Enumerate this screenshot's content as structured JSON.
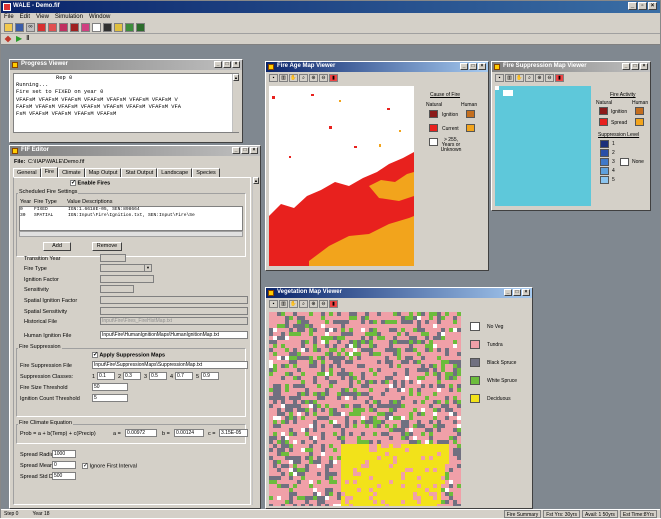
{
  "app": {
    "title": "WALE - Demo.fif",
    "menu": [
      "File",
      "Edit",
      "View",
      "Simulation",
      "Window"
    ],
    "status_left": [
      "Step 0",
      "Year 18"
    ],
    "status_right": [
      "Fire Summary",
      "Fst Yrs: 30yrs",
      "Avail: 1 50yrs",
      "Est Time:8Yrs"
    ]
  },
  "progress": {
    "title": "Progress Viewer",
    "lines": [
      "Rep 0",
      "Running...",
      "",
      "Fire set to FIXED on year 0",
      " VFAFsM VFAFsM VFAFsM VFAFsM VFAFsM VFAFsM VFAFsM V",
      "FAFsM VFAFsM VFAFsM VFAFsM VFAFsM VFAFsM VFAFsM VFA",
      "FsM VFAFsM VFAFsM VFAFsM VFAFsM"
    ]
  },
  "editor": {
    "title": "FIF Editor",
    "file_label": "File:",
    "file_path": "C:\\IIAP\\WALE\\Demo.fif",
    "tabs": [
      "General",
      "Fire",
      "Climate",
      "Map Output",
      "Stat Output",
      "Landscape",
      "Species"
    ],
    "enable_fires": "Enable Fires",
    "scheduled_title": "Scheduled Fire Settings",
    "table_headers": [
      "Year",
      "Fire Type",
      "Value Descriptions"
    ],
    "table_rows": [
      [
        "0",
        "FIXED",
        "IGN:1.6618E-05, SEN:898664"
      ],
      [
        "30",
        "SPATIAL",
        "IGN:Input\\Fire\\Ignition.txt, SEN:Input\\Fire\\Se"
      ]
    ],
    "add": "Add",
    "remove": "Remove",
    "fields": [
      "Transition Year",
      "Fire Type",
      "Ignition Factor",
      "Sensitivity",
      "Spatial Ignition Factor",
      "Spatial Sensitivity",
      "Historical File"
    ],
    "historical_file": "Input\\Fire\\Fires_FireHistMap.txt",
    "human_ignition_label": "Human Ignition File",
    "human_ignition_file": "Input\\Fire\\HumanIgnitionMaps\\HumanIgnitionMap.txt",
    "suppression_title": "Fire Suppression",
    "apply_suppression": "Apply Suppression Maps",
    "suppression_file_label": "Fire Suppression File",
    "suppression_file": "Input\\Fire\\SuppressionMaps\\SuppressionMap.txt",
    "suppression_classes_label": "Suppression Classes:",
    "classes": [
      {
        "n": "1",
        "v": "0.1"
      },
      {
        "n": "2",
        "v": "0.3"
      },
      {
        "n": "3",
        "v": "0.5"
      },
      {
        "n": "4",
        "v": "0.7"
      },
      {
        "n": "5",
        "v": "0.9"
      }
    ],
    "fire_size_label": "Fire Size Threshold",
    "fire_size": "50",
    "ignition_count_label": "Ignition Count Threshold",
    "ignition_count": "5",
    "climate_title": "Fire Climate Equation",
    "equation": "Prob = a + b(Temp) + c(Precip)",
    "a_label": "a =",
    "a": "0.00972",
    "b_label": "b =",
    "b": "0.00124",
    "c_label": "c =",
    "c": "3.15E-05",
    "spread_radius_label": "Spread Radius",
    "spread_radius": "1000",
    "spread_mean_label": "Spread Mean",
    "spread_mean": "0",
    "spread_stddev_label": "Spread Std Dev",
    "spread_stddev": "500",
    "ignore_first": "Ignore First Interval"
  },
  "fire_age": {
    "title": "Fire Age Map Viewer",
    "legend_title": "Cause of Fire",
    "col_natural": "Natural",
    "col_human": "Human",
    "rows": [
      "Ignition",
      "Current",
      "> 255, Years or Unknown"
    ],
    "colors": {
      "ign_nat": "#8b1a1a",
      "ign_hum": "#c46e1e",
      "cur_nat": "#e8211e",
      "cur_hum": "#f2a41c",
      "unk": "#ffffff"
    }
  },
  "suppression_map": {
    "title": "Fire Suppression Map Viewer",
    "activity_title": "Fire Activity",
    "col_natural": "Natural",
    "col_human": "Human",
    "ignition": "Ignition",
    "spread": "Spread",
    "level_title": "Suppression Level",
    "levels": [
      "1",
      "2",
      "3",
      "4",
      "5"
    ],
    "none": "None",
    "level_colors": [
      "#1b2f7a",
      "#2a4fa8",
      "#3f78c8",
      "#5fa0dc",
      "#8cc4ee"
    ],
    "map_color": "#5ec8da"
  },
  "vegetation": {
    "title": "Vegetation Map Viewer",
    "legend": [
      "No Veg",
      "Tundra",
      "Black Spruce",
      "White Spruce",
      "Deciduous"
    ],
    "colors": [
      "#ffffff",
      "#f0a0a8",
      "#707080",
      "#6cbc3c",
      "#f2e21a"
    ]
  }
}
